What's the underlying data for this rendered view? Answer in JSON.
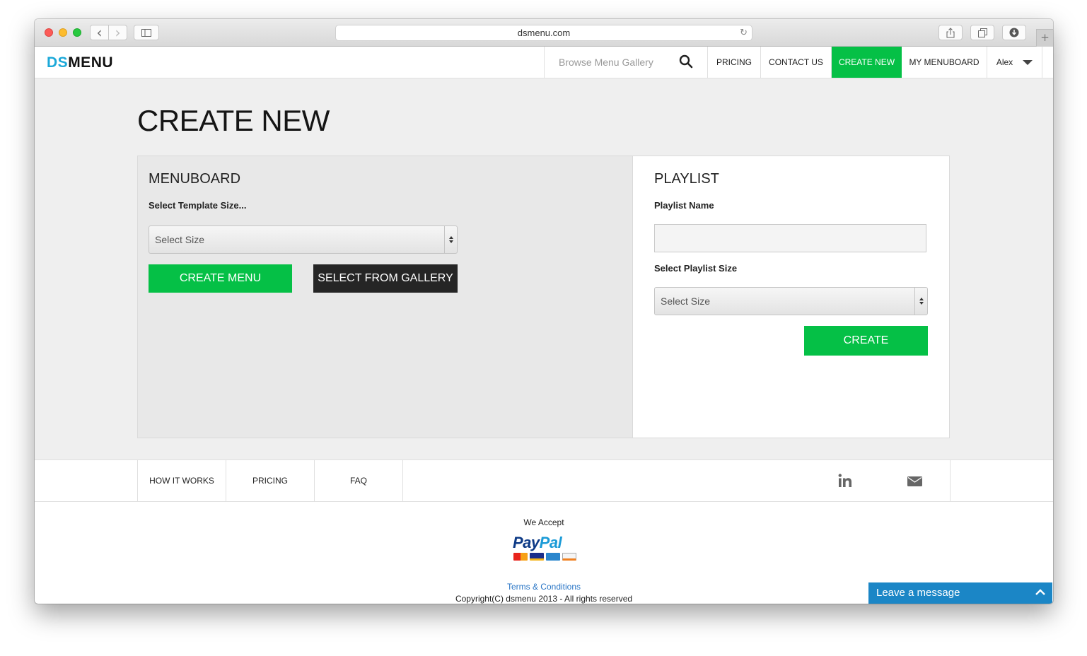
{
  "browser": {
    "url": "dsmenu.com",
    "back_glyph": "‹",
    "forward_glyph": "›",
    "reload_glyph": "↻",
    "newtab_glyph": "+"
  },
  "header": {
    "logo_ds": "DS",
    "logo_menu": "MENU",
    "search_placeholder": "Browse Menu Gallery",
    "nav": {
      "pricing": "PRICING",
      "contact": "CONTACT US",
      "create": "CREATE NEW",
      "menuboard": "MY MENUBOARD",
      "user": "Alex"
    }
  },
  "page": {
    "title": "CREATE NEW"
  },
  "menuboard": {
    "heading": "MENUBOARD",
    "size_label": "Select Template Size...",
    "size_select": "Select Size",
    "create_button": "CREATE MENU",
    "gallery_button": "SELECT FROM GALLERY"
  },
  "playlist": {
    "heading": "PLAYLIST",
    "name_label": "Playlist Name",
    "name_value": "",
    "size_label": "Select Playlist Size",
    "size_select": "Select Size",
    "create_button": "CREATE"
  },
  "footer": {
    "nav": {
      "how": "HOW IT WORKS",
      "pricing": "PRICING",
      "faq": "FAQ"
    },
    "we_accept": "We Accept",
    "paypal_a": "Pay",
    "paypal_b": "Pal",
    "terms": "Terms & Conditions",
    "copyright": "Copyright(C) dsmenu 2013 - All rights reserved"
  },
  "chat": {
    "label": "Leave a message",
    "chevron": "︿"
  },
  "colors": {
    "accent_green": "#05c046",
    "logo_blue": "#1ca9d9",
    "dark_button": "#252525",
    "chat_blue": "#1b86c6",
    "link_blue": "#2a76c6"
  }
}
